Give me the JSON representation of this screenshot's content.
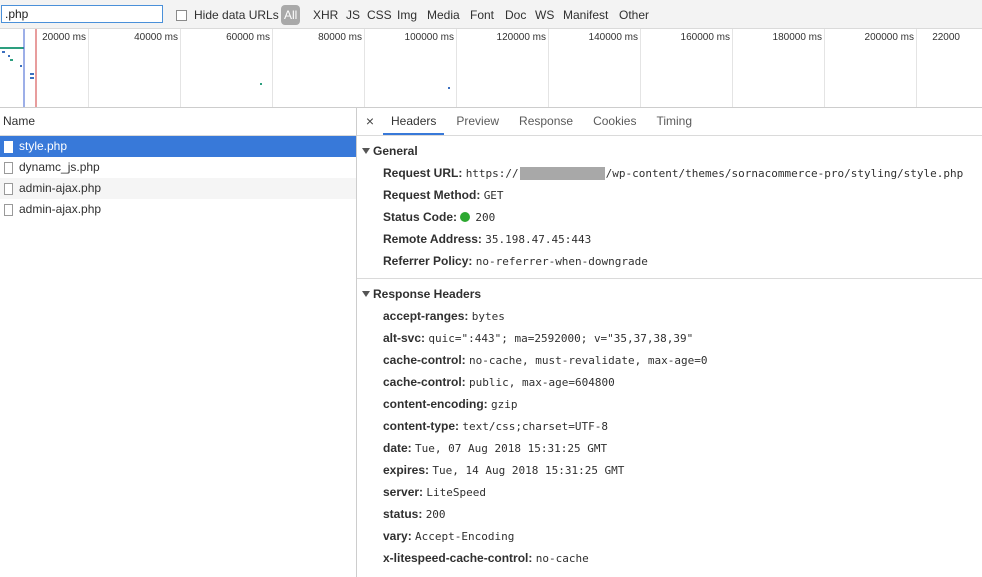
{
  "filter_bar": {
    "filter_value": ".php",
    "hide_data_urls_label": "Hide data URLs",
    "types": [
      "All",
      "XHR",
      "JS",
      "CSS",
      "Img",
      "Media",
      "Font",
      "Doc",
      "WS",
      "Manifest",
      "Other"
    ],
    "selected_type": "All"
  },
  "timeline": {
    "tick_labels": [
      "20000 ms",
      "40000 ms",
      "60000 ms",
      "80000 ms",
      "100000 ms",
      "120000 ms",
      "140000 ms",
      "160000 ms",
      "180000 ms",
      "200000 ms",
      "22000"
    ]
  },
  "requests": {
    "header": "Name",
    "items": [
      {
        "name": "style.php",
        "selected": true
      },
      {
        "name": "dynamc_js.php",
        "selected": false
      },
      {
        "name": "admin-ajax.php",
        "selected": false
      },
      {
        "name": "admin-ajax.php",
        "selected": false
      }
    ]
  },
  "detail": {
    "close": "×",
    "tabs": [
      "Headers",
      "Preview",
      "Response",
      "Cookies",
      "Timing"
    ],
    "active_tab": "Headers",
    "general": {
      "title": "General",
      "request_url_key": "Request URL:",
      "request_url_prefix": "https://",
      "request_url_suffix": "/wp-content/themes/sornacommerce-pro/styling/style.php",
      "request_method_key": "Request Method:",
      "request_method": "GET",
      "status_code_key": "Status Code:",
      "status_code": "200",
      "remote_address_key": "Remote Address:",
      "remote_address": "35.198.47.45:443",
      "referrer_policy_key": "Referrer Policy:",
      "referrer_policy": "no-referrer-when-downgrade",
      "status_color": "#2ca830"
    },
    "response_headers": {
      "title": "Response Headers",
      "items": [
        {
          "k": "accept-ranges:",
          "v": "bytes"
        },
        {
          "k": "alt-svc:",
          "v": "quic=\":443\"; ma=2592000; v=\"35,37,38,39\""
        },
        {
          "k": "cache-control:",
          "v": "no-cache, must-revalidate, max-age=0"
        },
        {
          "k": "cache-control:",
          "v": "public, max-age=604800"
        },
        {
          "k": "content-encoding:",
          "v": "gzip"
        },
        {
          "k": "content-type:",
          "v": "text/css;charset=UTF-8"
        },
        {
          "k": "date:",
          "v": "Tue, 07 Aug 2018 15:31:25 GMT"
        },
        {
          "k": "expires:",
          "v": "Tue, 14 Aug 2018 15:31:25 GMT"
        },
        {
          "k": "server:",
          "v": "LiteSpeed"
        },
        {
          "k": "status:",
          "v": "200"
        },
        {
          "k": "vary:",
          "v": "Accept-Encoding"
        },
        {
          "k": "x-litespeed-cache-control:",
          "v": "no-cache"
        }
      ]
    }
  },
  "colors": {
    "accent": "#3879d9",
    "selected_type_bg": "#a9a9a9"
  }
}
